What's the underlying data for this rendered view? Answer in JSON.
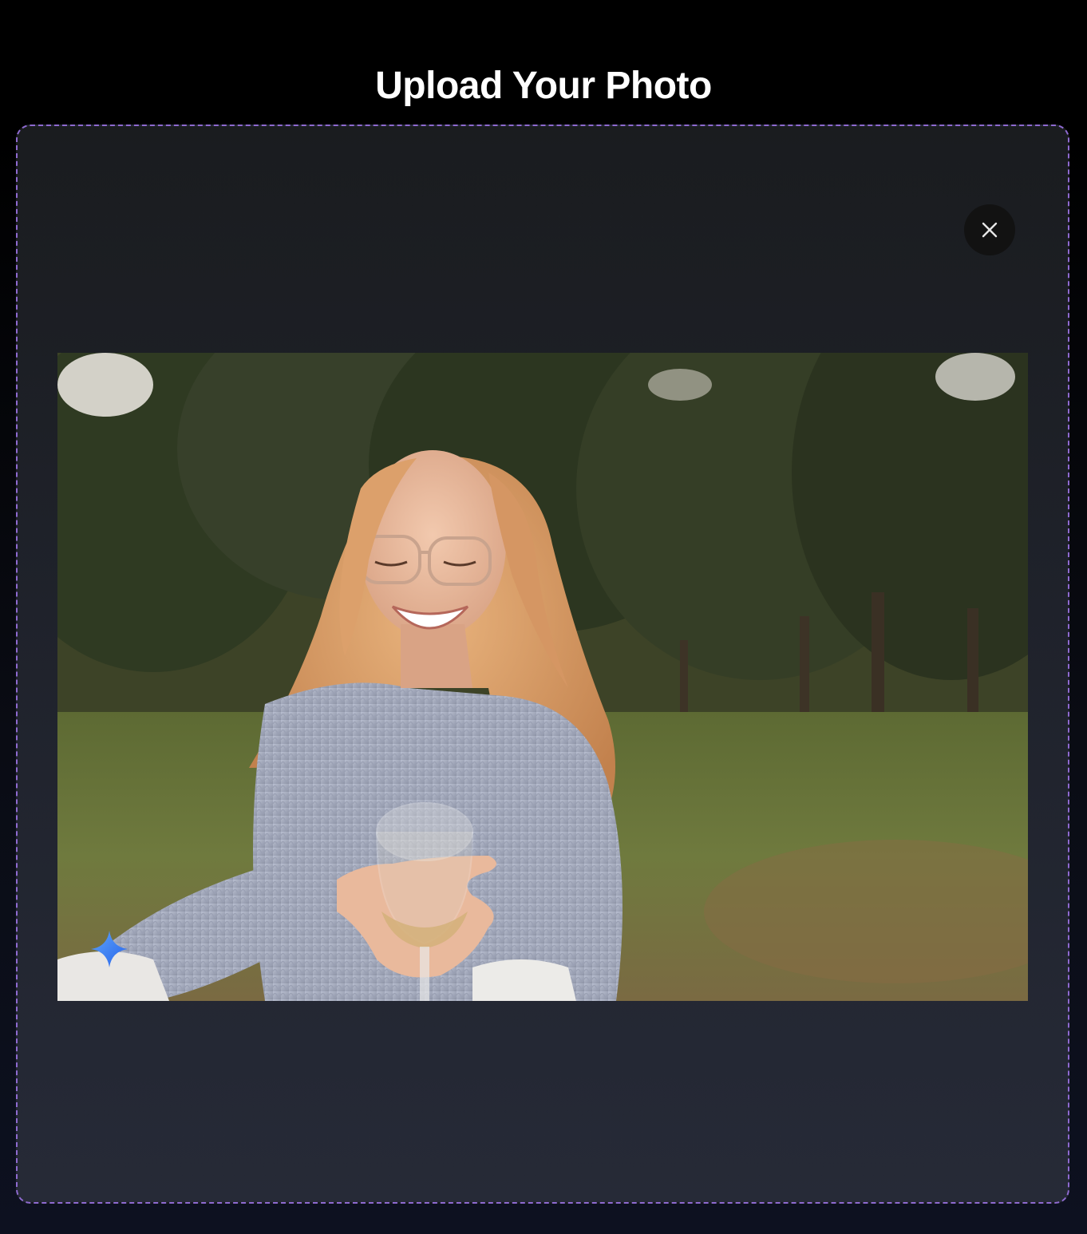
{
  "header": {
    "title": "Upload Your Photo"
  },
  "upload": {
    "close_icon": "close-icon",
    "image_alt": "Uploaded photo preview",
    "badge_icon": "sparkle-icon",
    "accent_border_color": "#8e6ad0",
    "badge_color": "#3b82f6"
  }
}
